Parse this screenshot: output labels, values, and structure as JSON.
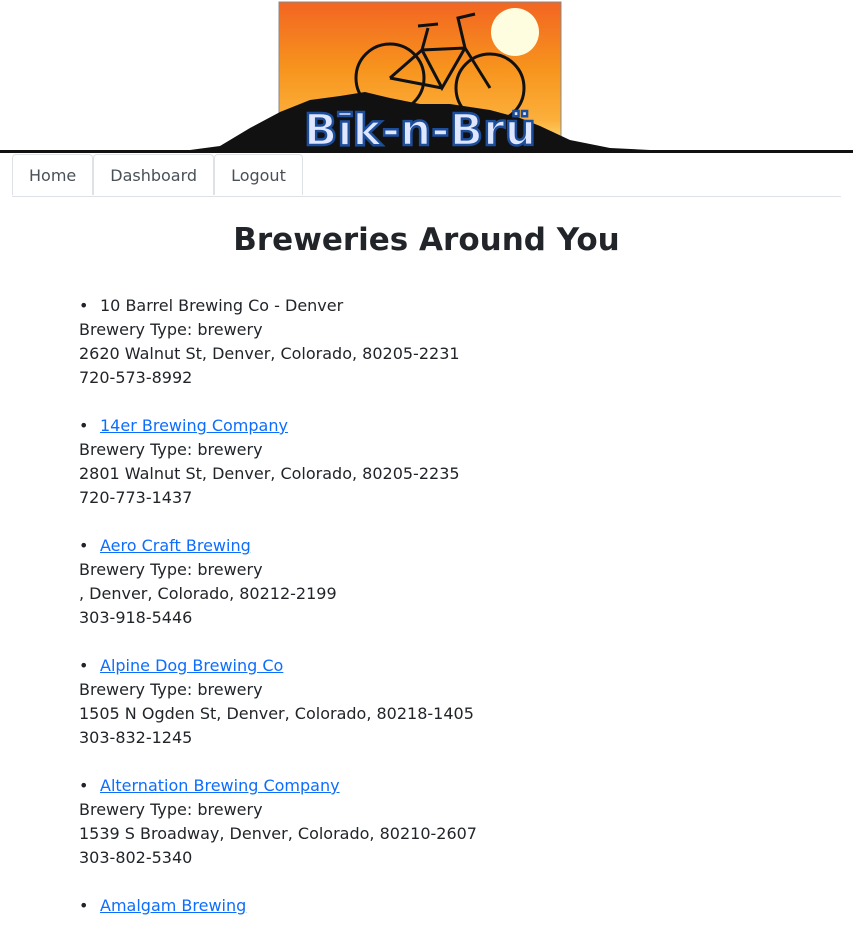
{
  "header": {
    "logo_text": "Bīk-n-Brü",
    "colors": {
      "sky_top": "#f7941d",
      "sky_mid": "#fbb03b",
      "sun": "#fffde0",
      "silhouette": "#111111",
      "logo_text": "#dfe6ff",
      "logo_text_outline": "#1d4e9c"
    }
  },
  "nav": {
    "tabs": [
      {
        "label": "Home"
      },
      {
        "label": "Dashboard"
      },
      {
        "label": "Logout"
      }
    ]
  },
  "main": {
    "title": "Breweries Around You",
    "breweries": [
      {
        "name": "10 Barrel Brewing Co - Denver",
        "is_link": false,
        "type_label": "Brewery Type: brewery",
        "address": "2620 Walnut St, Denver, Colorado, 80205-2231",
        "phone": "720-573-8992"
      },
      {
        "name": "14er Brewing Company",
        "is_link": true,
        "type_label": "Brewery Type: brewery",
        "address": "2801 Walnut St, Denver, Colorado, 80205-2235",
        "phone": "720-773-1437"
      },
      {
        "name": "Aero Craft Brewing",
        "is_link": true,
        "type_label": "Brewery Type: brewery",
        "address": ", Denver, Colorado, 80212-2199",
        "phone": "303-918-5446"
      },
      {
        "name": "Alpine Dog Brewing Co",
        "is_link": true,
        "type_label": "Brewery Type: brewery",
        "address": "1505 N Ogden St, Denver, Colorado, 80218-1405",
        "phone": "303-832-1245"
      },
      {
        "name": "Alternation Brewing Company",
        "is_link": true,
        "type_label": "Brewery Type: brewery",
        "address": "1539 S Broadway, Denver, Colorado, 80210-2607",
        "phone": "303-802-5340"
      },
      {
        "name": "Amalgam Brewing",
        "is_link": true,
        "type_label": "",
        "address": "",
        "phone": ""
      }
    ]
  }
}
